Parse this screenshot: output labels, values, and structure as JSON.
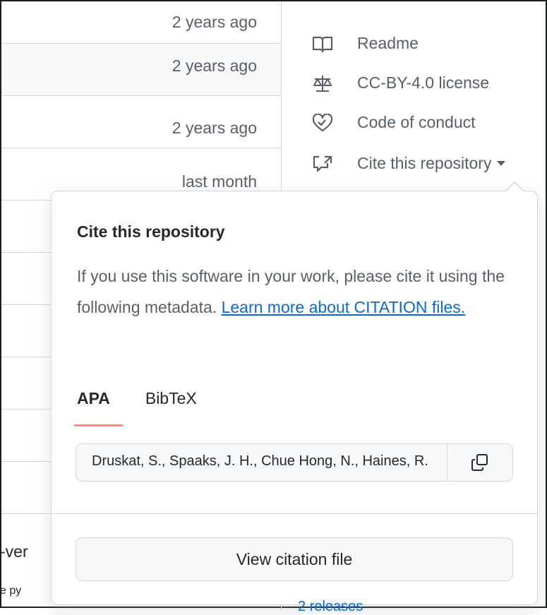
{
  "file_rows": [
    {
      "age": "2 years ago"
    },
    {
      "age": "2 years ago"
    },
    {
      "age": "2 years ago"
    },
    {
      "age": "last month"
    },
    {
      "age": ""
    },
    {
      "age": ""
    },
    {
      "age": ""
    },
    {
      "age": ""
    },
    {
      "age": ""
    },
    {
      "age": ""
    }
  ],
  "fragments": {
    "row10_left": "-ver",
    "row11_left": "e py",
    "releases_partial": "2 releases"
  },
  "sidebar": {
    "items": [
      {
        "label": "Readme",
        "icon": "book-icon"
      },
      {
        "label": "CC-BY-4.0 license",
        "icon": "law-icon"
      },
      {
        "label": "Code of conduct",
        "icon": "code-of-conduct-icon"
      },
      {
        "label": "Cite this repository",
        "icon": "quote-icon"
      }
    ]
  },
  "popover": {
    "title": "Cite this repository",
    "description": "If you use this software in your work, please cite it using the following metadata.",
    "link": "Learn more about CITATION files.",
    "tabs": [
      {
        "label": "APA",
        "active": true
      },
      {
        "label": "BibTeX",
        "active": false
      }
    ],
    "citation_text": "Druskat, S., Spaaks, J. H., Chue Hong, N., Haines, R.",
    "view_button": "View citation file"
  },
  "colors": {
    "accent_tab": "#fd8c73",
    "link": "#0969da",
    "border": "#d0d7de",
    "muted_text": "#57606a"
  }
}
